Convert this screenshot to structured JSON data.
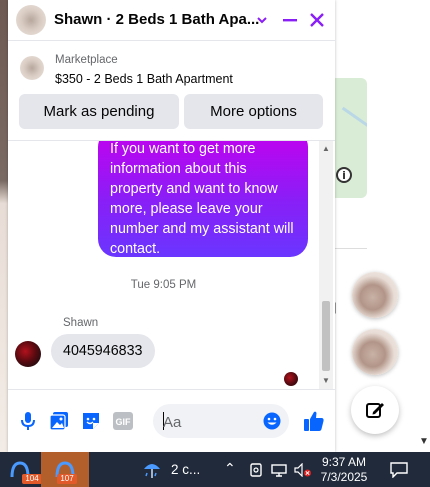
{
  "chat": {
    "title": "Shawn · 2 Beds 1 Bath Apa...",
    "marketplace_label": "Marketplace",
    "listing_title": "$350 - 2 Beds 1 Bath Apartment",
    "mark_pending_label": "Mark as pending",
    "more_options_label": "More options",
    "messages": {
      "outgoing_text": "If you want to get more information about this property and want to know more, please leave your number and my assistant will contact.",
      "timestamp": "Tue 9:05 PM",
      "sender_name": "Shawn",
      "incoming_text": "4045946833"
    },
    "composer": {
      "placeholder": "Aa",
      "gif_label": "GIF"
    },
    "accent_color": "#0866ff"
  },
  "taskbar": {
    "app1_badge": "104",
    "app2_badge": "107",
    "weather_text": "2 c...",
    "time": "9:37 AM",
    "date": "7/3/2025"
  }
}
